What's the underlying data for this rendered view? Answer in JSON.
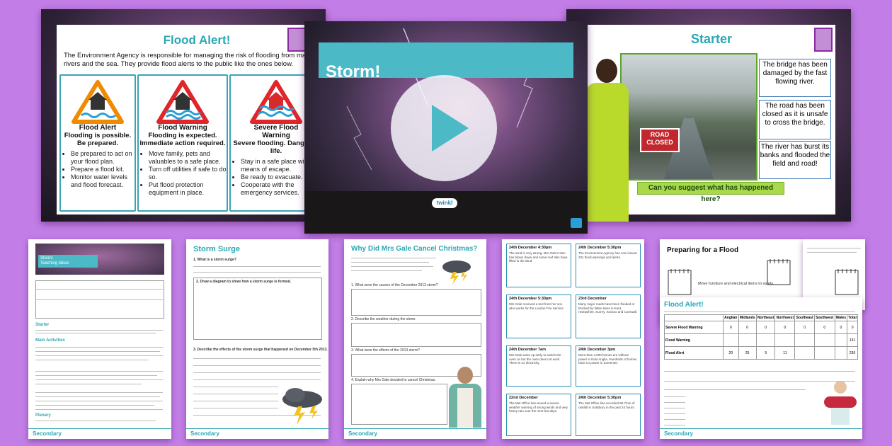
{
  "slides": {
    "flood_alert": {
      "title": "Flood Alert!",
      "intro": "The Environment Agency is responsible for managing the risk of flooding from main rivers and the sea. They provide flood alerts to the public like the ones below.",
      "cards": [
        {
          "heading": "Flood Alert",
          "subtitle": "Flooding is possible. Be prepared.",
          "bullets": [
            "Be prepared to act on your flood plan.",
            "Prepare a flood kit.",
            "Monitor water levels and flood forecast."
          ]
        },
        {
          "heading": "Flood Warning",
          "subtitle": "Flooding is expected. Immediate action required.",
          "bullets": [
            "Move family, pets and valuables to a safe place.",
            "Turn off utilities if safe to do so.",
            "Put flood protection equipment in place."
          ]
        },
        {
          "heading": "Severe Flood Warning",
          "subtitle": "Severe flooding. Danger to life.",
          "bullets": [
            "Stay in a safe place with a means of escape.",
            "Be ready to evacuate.",
            "Cooperate with the emergency services."
          ]
        }
      ]
    },
    "storm": {
      "title": "Storm!",
      "logo": "twinkl"
    },
    "starter": {
      "title": "Starter",
      "sign": "ROAD CLOSED",
      "notes": [
        "The bridge has been damaged by the fast flowing river.",
        "The road has been closed as it is unsafe to cross the bridge.",
        "The river has burst its banks and flooded the field and road!"
      ],
      "question": "Can you suggest what has happened here?"
    }
  },
  "pages": {
    "teaching": {
      "title": "Storm!",
      "subtitle": "Teaching Ideas",
      "sections": [
        "Starter",
        "Main Activities",
        "Plenary"
      ],
      "footer": "Secondary"
    },
    "surge": {
      "title": "Storm Surge",
      "q1": "1. What is a storm surge?",
      "q2": "2. Draw a diagram to show how a storm surge is formed.",
      "q3": "3. Describe the effects of the storm surge that happened on December 5th 2013.",
      "footer": "Secondary"
    },
    "christmas": {
      "title": "Why Did Mrs Gale Cancel Christmas?",
      "q1": "1. What were the causes of the December 2013 storm?",
      "q2": "2. Describe the weather during the storm.",
      "q3": "3. What were the effects of the 2013 storm?",
      "q4": "4. Explain why Mrs Gale decided to cancel Christmas.",
      "footer": "Secondary"
    },
    "cards": {
      "items": [
        "24th December 4:30pm",
        "24th December 5:30pm",
        "24th December 5:30pm",
        "23rd December",
        "24th December 7am",
        "24th December 3pm",
        "22nd December",
        "24th December 5:30pm"
      ]
    },
    "preparing": {
      "title": "Preparing for a Flood",
      "bullet": "Move furniture and electrical items to safety."
    },
    "flood_table": {
      "title": "Flood Alert!",
      "columns": [
        "Anglian",
        "Midlands",
        "Northeast",
        "Northwest",
        "Southeast",
        "Southwest",
        "Wales",
        "Total"
      ],
      "rows": [
        {
          "label": "Severe Flood Warning",
          "values": [
            "0",
            "0",
            "0",
            "0",
            "0",
            "0",
            "0",
            "0"
          ]
        },
        {
          "label": "Flood Warning",
          "values": [
            "",
            "",
            "",
            "",
            "",
            "",
            "",
            "131"
          ]
        },
        {
          "label": "Flood Alert",
          "values": [
            "20",
            "25",
            "9",
            "11",
            "",
            "",
            "",
            "236"
          ]
        }
      ],
      "footer": "Secondary"
    }
  }
}
